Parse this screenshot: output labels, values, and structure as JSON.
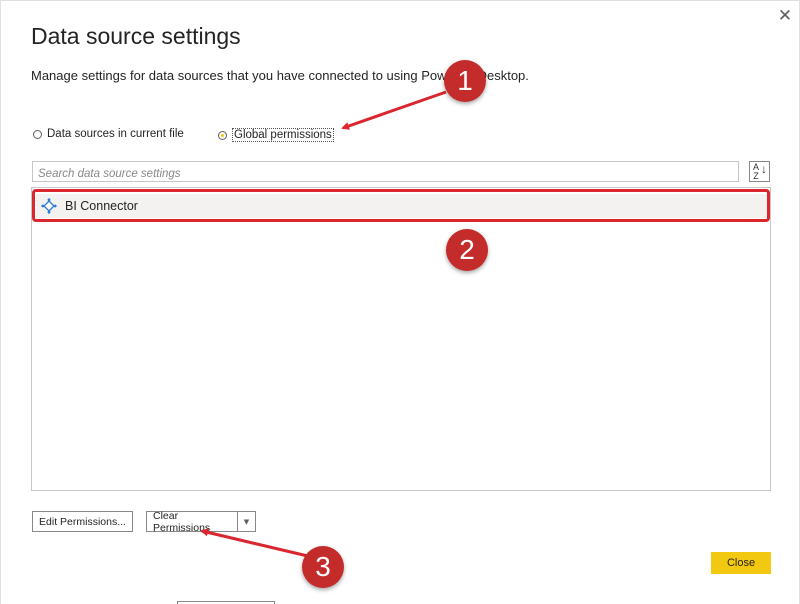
{
  "dialog": {
    "title": "Data source settings",
    "description": "Manage settings for data sources that you have connected to using Power BI Desktop.",
    "close_glyph": "✕"
  },
  "scope": {
    "option_current": "Data sources in current file",
    "option_global": "Global permissions",
    "selected": "Global permissions"
  },
  "search": {
    "placeholder": "Search data source settings",
    "value": ""
  },
  "sort": {
    "top": "A",
    "bottom": "Z",
    "arrow": "↓",
    "icon": "sort-az-icon"
  },
  "list": {
    "items": [
      {
        "label": "BI Connector",
        "icon": "connector-icon",
        "selected": true
      }
    ]
  },
  "buttons": {
    "edit_permissions": "Edit Permissions...",
    "clear_permissions": "Clear Permissions",
    "clear_dropdown": "▼",
    "close": "Close"
  },
  "annotations": {
    "step1": "1",
    "step2": "2",
    "step3": "3"
  },
  "colors": {
    "accent": "#f2c811",
    "highlight": "#d9262f",
    "badge": "#c42b2b"
  }
}
